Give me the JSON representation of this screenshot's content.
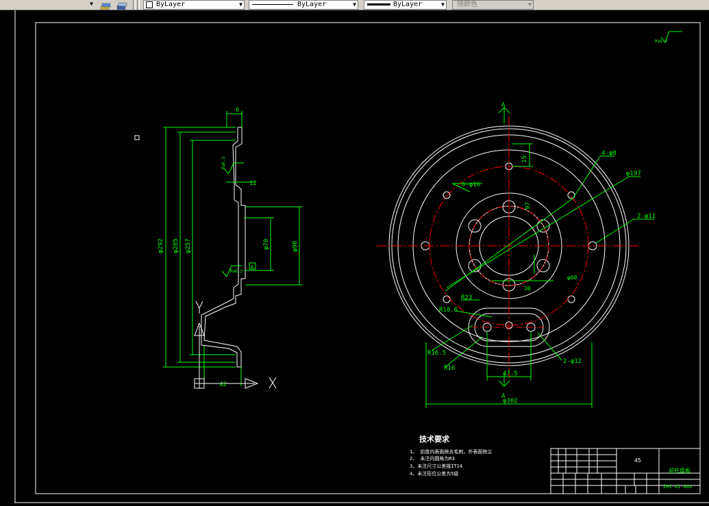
{
  "toolbar": {
    "layer_color_label": "ByLayer",
    "linetype_label": "ByLayer",
    "lineweight_label": "ByLayer",
    "plotstyle_label": "随颜色"
  },
  "drawing": {
    "section_labels": {
      "dim_6": "6",
      "dim_12": "12",
      "dia_292": "φ292",
      "dia_285": "φ285",
      "dia_257": "φ257",
      "dia_70": "φ70",
      "dia_98": "φ98",
      "dim_42": "42",
      "rough_a": "Ra6.3",
      "rough_b": "Ra6.3",
      "rough_c": "Ra6.3",
      "ref_box": "A"
    },
    "front_labels": {
      "section_top": "A",
      "section_bottom": "A",
      "holes_4": "4-φ8",
      "dia_197": "φ197",
      "holes_6": "6-φ16",
      "dim_15": "15",
      "dim_97": "97",
      "holes_2_11": "2-φ11",
      "dia_60": "φ60",
      "dim_30": "30",
      "r23": "R23",
      "r10": "R10.6",
      "r16_5": "R16.5",
      "r16": "R16",
      "holes_2_12": "2-φ12",
      "dim_47_5": "47.5",
      "dia_302": "φ302"
    },
    "roughness_corner": "Ra6.3",
    "tech": {
      "title": "技术要求",
      "items": [
        "1、 前盘内表面除去毛刺，外表面除尘",
        "2、 未注内圆角为R3",
        "3、未注尺寸公差按IT14",
        "4、未注形位公差为5级"
      ]
    },
    "titleblock": {
      "material": "45",
      "part_name": "前托盘板",
      "drawing_no": "ZHS-01-003"
    }
  }
}
